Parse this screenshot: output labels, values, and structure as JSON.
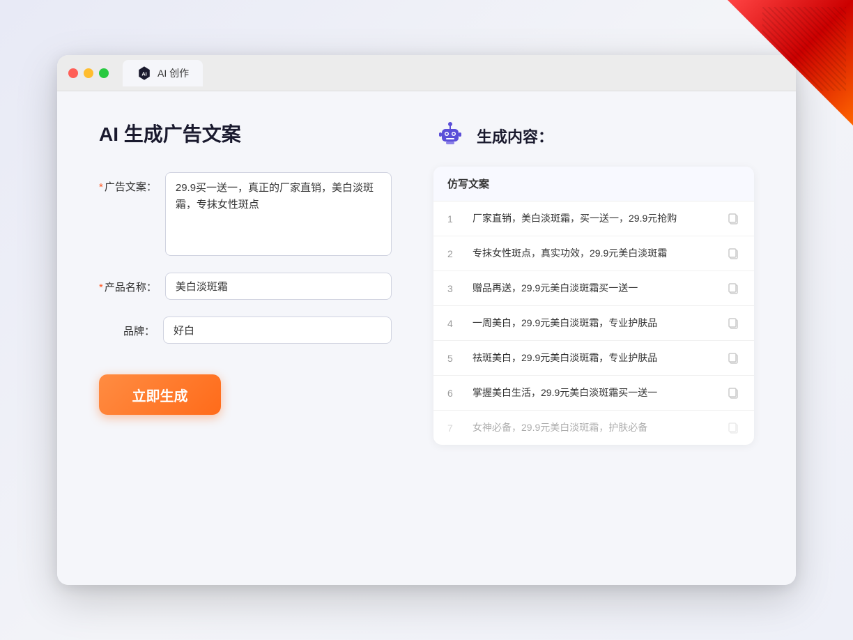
{
  "window": {
    "title": "AI 创作",
    "controls": {
      "close": "close",
      "minimize": "minimize",
      "maximize": "maximize"
    }
  },
  "left_panel": {
    "title": "AI 生成广告文案",
    "form": {
      "ad_copy_label": "广告文案：",
      "ad_copy_required": "*",
      "ad_copy_value": "29.9买一送一，真正的厂家直销，美白淡斑霜，专抹女性斑点",
      "product_name_label": "产品名称：",
      "product_name_required": "*",
      "product_name_value": "美白淡斑霜",
      "brand_label": "品牌：",
      "brand_value": "好白"
    },
    "generate_button": "立即生成"
  },
  "right_panel": {
    "header_title": "生成内容：",
    "table_header": "仿写文案",
    "results": [
      {
        "number": "1",
        "text": "厂家直销，美白淡斑霜，买一送一，29.9元抢购"
      },
      {
        "number": "2",
        "text": "专抹女性斑点，真实功效，29.9元美白淡斑霜"
      },
      {
        "number": "3",
        "text": "赠品再送，29.9元美白淡斑霜买一送一"
      },
      {
        "number": "4",
        "text": "一周美白，29.9元美白淡斑霜，专业护肤品"
      },
      {
        "number": "5",
        "text": "祛斑美白，29.9元美白淡斑霜，专业护肤品"
      },
      {
        "number": "6",
        "text": "掌握美白生活，29.9元美白淡斑霜买一送一"
      },
      {
        "number": "7",
        "text": "女神必备，29.9元美白淡斑霜，护肤必备",
        "faded": true
      }
    ]
  }
}
